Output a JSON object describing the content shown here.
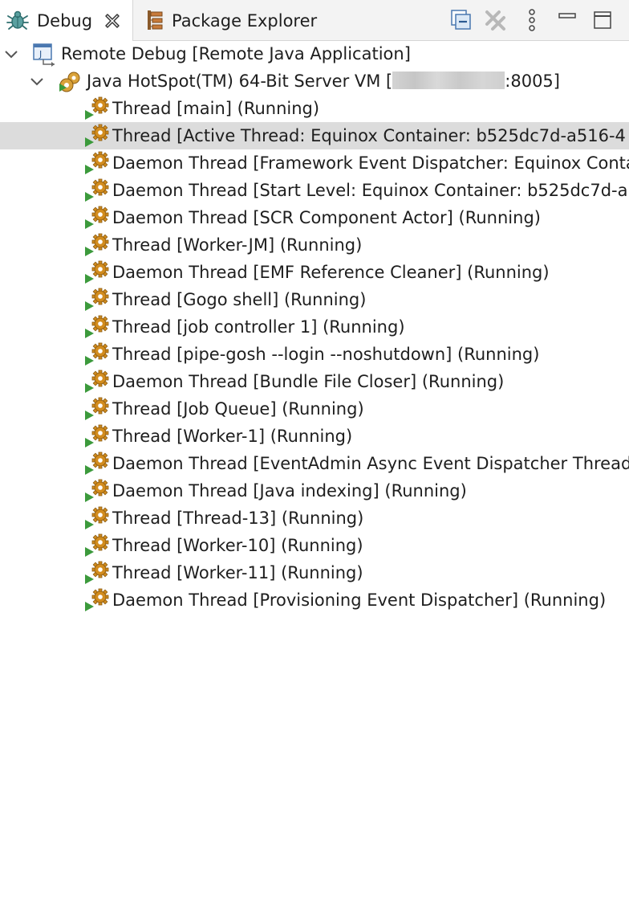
{
  "tabs": [
    {
      "label": "Debug",
      "active": true,
      "icon": "bug-icon"
    },
    {
      "label": "Package Explorer",
      "active": false,
      "icon": "package-explorer-icon"
    }
  ],
  "toolbar": [
    {
      "name": "collapse-all",
      "icon": "collapse-all-icon"
    },
    {
      "name": "remove-all-terminated",
      "icon": "remove-all-icon"
    },
    {
      "name": "view-menu",
      "icon": "vertical-ellipsis-icon"
    },
    {
      "name": "minimize",
      "icon": "minimize-icon"
    },
    {
      "name": "maximize",
      "icon": "maximize-icon"
    }
  ],
  "tree": {
    "launch": {
      "label": "Remote Debug [Remote Java Application]",
      "expanded": true
    },
    "vm": {
      "label_prefix": "Java HotSpot(TM) 64-Bit Server VM [",
      "label_suffix": ":8005]",
      "expanded": true
    },
    "threads": [
      {
        "label": "Thread [main] (Running)"
      },
      {
        "label": "Thread [Active Thread: Equinox Container: b525dc7d-a516-4",
        "selected": true
      },
      {
        "label": "Daemon Thread [Framework Event Dispatcher: Equinox Conta"
      },
      {
        "label": "Daemon Thread [Start Level: Equinox Container: b525dc7d-a"
      },
      {
        "label": "Daemon Thread [SCR Component Actor] (Running)"
      },
      {
        "label": "Thread [Worker-JM] (Running)"
      },
      {
        "label": "Daemon Thread [EMF Reference Cleaner] (Running)"
      },
      {
        "label": "Thread [Gogo shell] (Running)"
      },
      {
        "label": "Thread [job controller 1] (Running)"
      },
      {
        "label": "Thread [pipe-gosh --login --noshutdown] (Running)"
      },
      {
        "label": "Daemon Thread [Bundle File Closer] (Running)"
      },
      {
        "label": "Thread [Job Queue] (Running)"
      },
      {
        "label": "Thread [Worker-1] (Running)"
      },
      {
        "label": "Daemon Thread [EventAdmin Async Event Dispatcher Thread"
      },
      {
        "label": "Daemon Thread [Java indexing] (Running)"
      },
      {
        "label": "Thread [Thread-13] (Running)"
      },
      {
        "label": "Thread [Worker-10] (Running)"
      },
      {
        "label": "Thread [Worker-11] (Running)"
      },
      {
        "label": "Daemon Thread [Provisioning Event Dispatcher] (Running)"
      }
    ]
  },
  "colors": {
    "selection": "#dcdcdc",
    "tabbar": "#f3f3f3",
    "thread_gear": "#d28c1e",
    "thread_play": "#3c9a3c"
  }
}
